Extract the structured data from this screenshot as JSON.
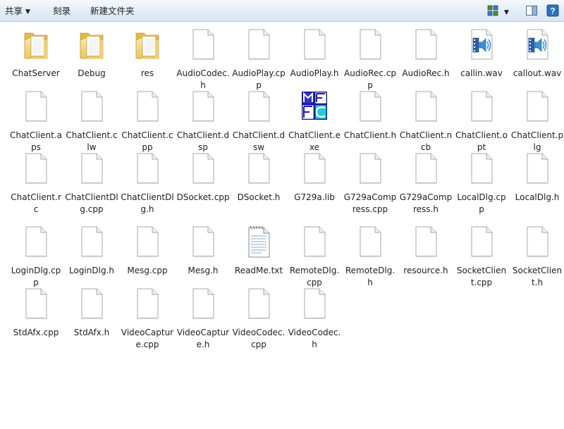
{
  "toolbar": {
    "share_label": "共享",
    "burn_label": "刻录",
    "new_folder_label": "新建文件夹"
  },
  "files": [
    {
      "name": "ChatServer",
      "icon": "folder-icon"
    },
    {
      "name": "Debug",
      "icon": "folder-icon"
    },
    {
      "name": "res",
      "icon": "folder-icon"
    },
    {
      "name": "AudioCodec.h",
      "icon": "file-icon"
    },
    {
      "name": "AudioPlay.cpp",
      "icon": "file-icon"
    },
    {
      "name": "AudioPlay.h",
      "icon": "file-icon"
    },
    {
      "name": "AudioRec.cpp",
      "icon": "file-icon"
    },
    {
      "name": "AudioRec.h",
      "icon": "file-icon"
    },
    {
      "name": "callin.wav",
      "icon": "audio-file-icon"
    },
    {
      "name": "callout.wav",
      "icon": "audio-file-icon"
    },
    {
      "name": "ChatClient.aps",
      "icon": "file-icon"
    },
    {
      "name": "ChatClient.clw",
      "icon": "file-icon"
    },
    {
      "name": "ChatClient.cpp",
      "icon": "file-icon"
    },
    {
      "name": "ChatClient.dsp",
      "icon": "file-icon"
    },
    {
      "name": "ChatClient.dsw",
      "icon": "file-icon"
    },
    {
      "name": "ChatClient.exe",
      "icon": "mfc-exe-icon"
    },
    {
      "name": "ChatClient.h",
      "icon": "file-icon"
    },
    {
      "name": "ChatClient.ncb",
      "icon": "file-icon"
    },
    {
      "name": "ChatClient.opt",
      "icon": "file-icon"
    },
    {
      "name": "ChatClient.plg",
      "icon": "file-icon"
    },
    {
      "name": "ChatClient.rc",
      "icon": "file-icon"
    },
    {
      "name": "ChatClientDlg.cpp",
      "icon": "file-icon"
    },
    {
      "name": "ChatClientDlg.h",
      "icon": "file-icon"
    },
    {
      "name": "DSocket.cpp",
      "icon": "file-icon"
    },
    {
      "name": "DSocket.h",
      "icon": "file-icon"
    },
    {
      "name": "G729a.lib",
      "icon": "file-icon"
    },
    {
      "name": "G729aCompress.cpp",
      "icon": "file-icon"
    },
    {
      "name": "G729aCompress.h",
      "icon": "file-icon"
    },
    {
      "name": "LocalDlg.cpp",
      "icon": "file-icon"
    },
    {
      "name": "LocalDlg.h",
      "icon": "file-icon"
    },
    {
      "name": "LoginDlg.cpp",
      "icon": "file-icon"
    },
    {
      "name": "LoginDlg.h",
      "icon": "file-icon"
    },
    {
      "name": "Mesg.cpp",
      "icon": "file-icon"
    },
    {
      "name": "Mesg.h",
      "icon": "file-icon"
    },
    {
      "name": "ReadMe.txt",
      "icon": "text-file-icon"
    },
    {
      "name": "RemoteDlg.cpp",
      "icon": "file-icon"
    },
    {
      "name": "RemoteDlg.h",
      "icon": "file-icon"
    },
    {
      "name": "resource.h",
      "icon": "file-icon"
    },
    {
      "name": "SocketClient.cpp",
      "icon": "file-icon"
    },
    {
      "name": "SocketClient.h",
      "icon": "file-icon"
    },
    {
      "name": "StdAfx.cpp",
      "icon": "file-icon"
    },
    {
      "name": "StdAfx.h",
      "icon": "file-icon"
    },
    {
      "name": "VideoCapture.cpp",
      "icon": "file-icon"
    },
    {
      "name": "VideoCapture.h",
      "icon": "file-icon"
    },
    {
      "name": "VideoCodec.cpp",
      "icon": "file-icon"
    },
    {
      "name": "VideoCodec.h",
      "icon": "file-icon"
    }
  ]
}
